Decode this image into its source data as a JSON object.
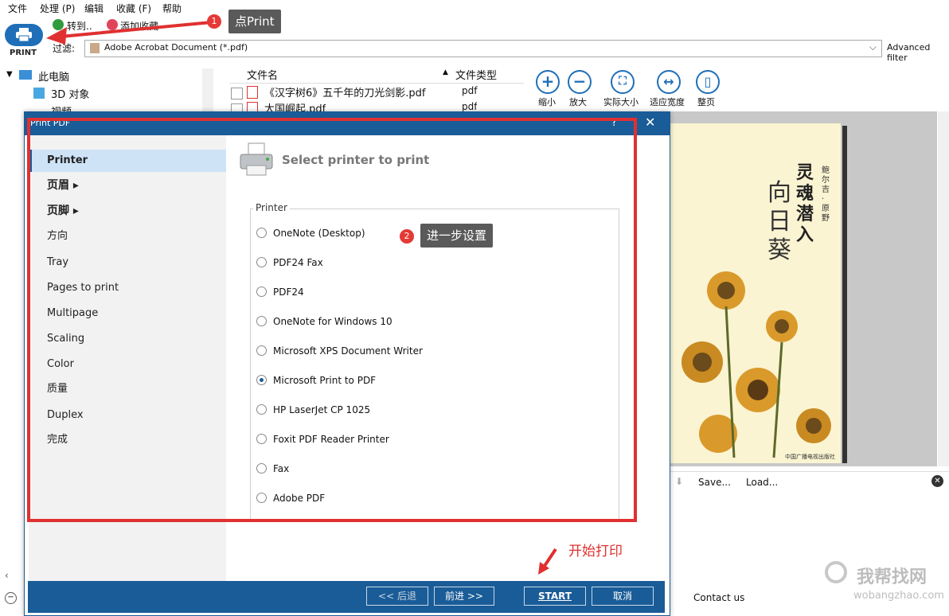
{
  "menubar": {
    "items": [
      "文件",
      "处理 (P)",
      "编辑",
      "收藏 (F)",
      "帮助"
    ]
  },
  "toolbar": {
    "print_label": "PRINT",
    "goto_label": "转到..",
    "favorite_label": "添加收藏",
    "filter_label": "过滤:",
    "filter_value": "Adobe Acrobat Document (*.pdf)",
    "advanced_filter": "Advanced filter"
  },
  "tree": {
    "root": "此电脑",
    "items": [
      "3D 对象",
      "视频"
    ]
  },
  "filelist": {
    "col_name": "文件名",
    "col_type": "文件类型",
    "rows": [
      {
        "name": "《汉字树6》五千年的刀光剑影.pdf",
        "type": "pdf"
      },
      {
        "name": "大国崛起.pdf",
        "type": "pdf"
      }
    ]
  },
  "zoom": {
    "buttons": [
      {
        "label": "缩小",
        "glyph": "+"
      },
      {
        "label": "放大",
        "glyph": "−"
      },
      {
        "label": "实际大小",
        "glyph": "⛶"
      },
      {
        "label": "适应宽度",
        "glyph": "↔"
      },
      {
        "label": "整页",
        "glyph": "▯"
      }
    ]
  },
  "preview": {
    "book_title": "灵魂潜入",
    "book_title2": "向日葵",
    "author": "鲍尔吉·原野",
    "publisher": "中国广播电视出版社"
  },
  "saveload": {
    "save": "Save...",
    "load": "Load..."
  },
  "dialog": {
    "title": "Print PDF",
    "help": "?",
    "close": "✕",
    "sidebar": [
      {
        "label": "Printer",
        "active": true,
        "bold": false
      },
      {
        "label": "页眉 ▸",
        "active": false,
        "bold": true
      },
      {
        "label": "页脚 ▸",
        "active": false,
        "bold": true
      },
      {
        "label": "方向",
        "active": false,
        "bold": false
      },
      {
        "label": "Tray",
        "active": false,
        "bold": false
      },
      {
        "label": "Pages to print",
        "active": false,
        "bold": false
      },
      {
        "label": "Multipage",
        "active": false,
        "bold": false
      },
      {
        "label": "Scaling",
        "active": false,
        "bold": false
      },
      {
        "label": "Color",
        "active": false,
        "bold": false
      },
      {
        "label": "质量",
        "active": false,
        "bold": false
      },
      {
        "label": "Duplex",
        "active": false,
        "bold": false
      },
      {
        "label": "完成",
        "active": false,
        "bold": false
      }
    ],
    "heading": "Select printer to print",
    "group_label": "Printer",
    "printers": [
      {
        "name": "OneNote (Desktop)",
        "selected": false
      },
      {
        "name": "PDF24 Fax",
        "selected": false
      },
      {
        "name": "PDF24",
        "selected": false
      },
      {
        "name": "OneNote for Windows 10",
        "selected": false
      },
      {
        "name": "Microsoft XPS Document Writer",
        "selected": false
      },
      {
        "name": "Microsoft Print to PDF",
        "selected": true
      },
      {
        "name": "HP LaserJet CP 1025",
        "selected": false
      },
      {
        "name": "Foxit PDF Reader Printer",
        "selected": false
      },
      {
        "name": "Fax",
        "selected": false
      },
      {
        "name": "Adobe PDF",
        "selected": false
      }
    ],
    "footer": {
      "back": "<< 后退",
      "next": "前进 >>",
      "start": "START",
      "cancel": "取消"
    }
  },
  "annotations": {
    "badge1": "1",
    "tip1": "点Print",
    "badge2": "2",
    "tip2": "进一步设置",
    "start_note": "开始打印"
  },
  "contact": "Contact us",
  "watermark": {
    "text": "我帮找网",
    "url": "wobangzhao.com"
  },
  "colors": {
    "accent": "#1a5c97",
    "annotation_red": "#e03030"
  }
}
